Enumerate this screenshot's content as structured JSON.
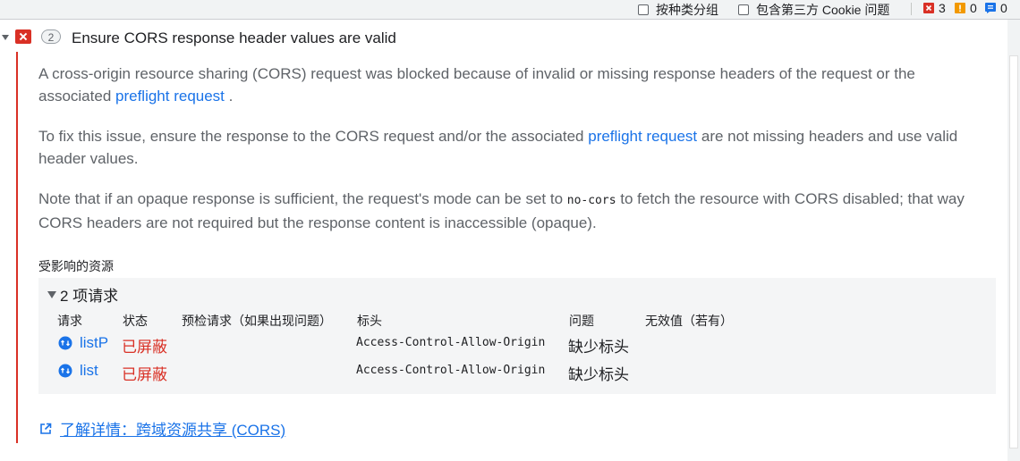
{
  "toolbar": {
    "group_by_kind_label": "按种类分组",
    "third_party_cookie_label": "包含第三方 Cookie 问题",
    "error_count": "3",
    "warning_count": "0",
    "info_count": "0"
  },
  "issue": {
    "count": "2",
    "title": "Ensure CORS response header values are valid",
    "para1_text": "A cross-origin resource sharing (CORS) request was blocked because of invalid or missing response headers of the request or the associated ",
    "para1_link": "preflight request",
    "para1_tail": " .",
    "para2_text": "To fix this issue, ensure the response to the CORS request and/or the associated ",
    "para2_link": "preflight request",
    "para2_tail": " are not missing headers and use valid header values.",
    "para3_pre": "Note that if an opaque response is sufficient, the request's mode can be set to ",
    "para3_code": "no-cors",
    "para3_post": " to fetch the resource with CORS disabled; that way CORS headers are not required but the response content is inaccessible (opaque).",
    "affected_label": "受影响的资源",
    "group_label": "2 项请求",
    "columns": [
      "请求",
      "状态",
      "预检请求（如果出现问题）",
      "标头",
      "问题",
      "无效值（若有）"
    ],
    "rows": [
      {
        "request": "listP",
        "status": "已屏蔽",
        "header": "Access-Control-Allow-Origin",
        "problem": "缺少标头"
      },
      {
        "request": "list",
        "status": "已屏蔽",
        "header": "Access-Control-Allow-Origin",
        "problem": "缺少标头"
      }
    ],
    "learn_more": "了解详情：跨域资源共享 (CORS)"
  },
  "colors": {
    "error": "#d93025",
    "link": "#1a73e8",
    "warning": "#f29900",
    "info": "#1a73e8"
  }
}
